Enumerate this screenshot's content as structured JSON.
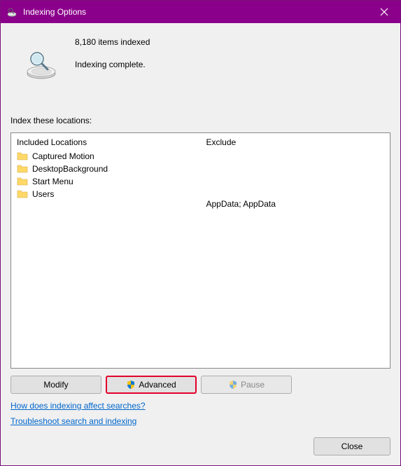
{
  "titlebar": {
    "title": "Indexing Options"
  },
  "status": {
    "count_text": "8,180 items indexed",
    "message": "Indexing complete."
  },
  "locations": {
    "label": "Index these locations:",
    "included_header": "Included Locations",
    "exclude_header": "Exclude",
    "items": [
      {
        "name": "Captured Motion",
        "exclude": ""
      },
      {
        "name": "DesktopBackground",
        "exclude": ""
      },
      {
        "name": "Start Menu",
        "exclude": ""
      },
      {
        "name": "Users",
        "exclude": "AppData; AppData"
      }
    ]
  },
  "buttons": {
    "modify": "Modify",
    "advanced": "Advanced",
    "pause": "Pause",
    "close": "Close"
  },
  "links": {
    "help": "How does indexing affect searches?",
    "troubleshoot": "Troubleshoot search and indexing"
  }
}
